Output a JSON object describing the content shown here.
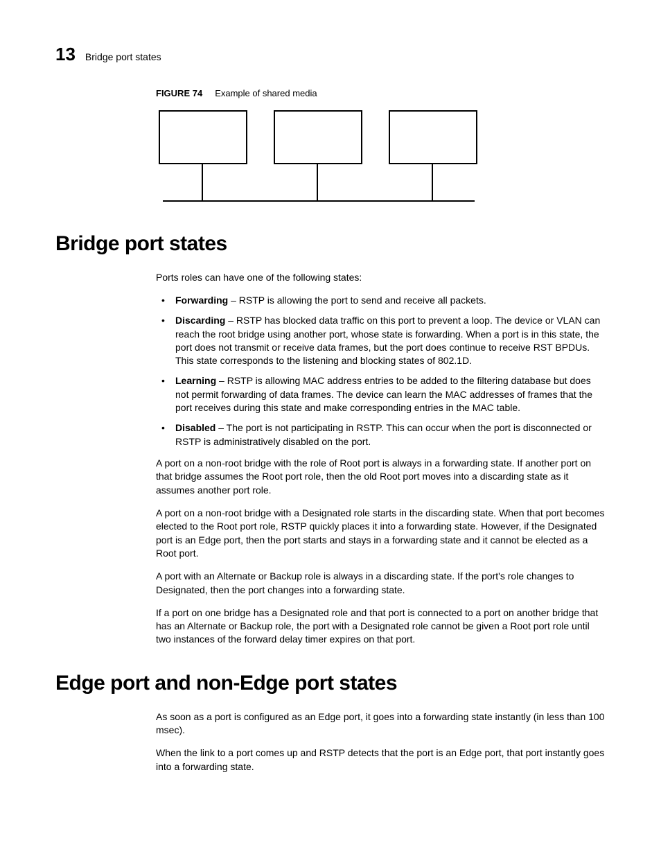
{
  "header": {
    "page_number": "13",
    "running_title": "Bridge port states"
  },
  "figure": {
    "label": "FIGURE 74",
    "caption": "Example of shared media"
  },
  "section1": {
    "heading": "Bridge port states",
    "intro": "Ports roles can have one of the following states:",
    "bullets": [
      {
        "term": "Forwarding",
        "desc": " – RSTP is allowing the port to send and receive all packets."
      },
      {
        "term": "Discarding",
        "desc": " – RSTP has blocked data traffic on this port to prevent a loop. The device or VLAN can reach the root bridge using another port, whose state is forwarding. When a port is in this state, the port does not transmit or receive data frames, but the port does continue to receive RST BPDUs. This state corresponds to the listening and blocking states of 802.1D."
      },
      {
        "term": "Learning",
        "desc": " – RSTP is allowing MAC address entries to be added to the filtering database but does not permit forwarding of data frames. The device can learn the MAC addresses of frames that the port receives during this state and make corresponding entries in the MAC table."
      },
      {
        "term": "Disabled",
        "desc": " – The port is not participating in RSTP. This can occur when the port is disconnected or RSTP is administratively disabled on the port."
      }
    ],
    "paras": [
      "A port on a non-root bridge with the role of Root port is always in a forwarding state. If another port on that bridge assumes the Root port role, then the old Root port moves into a discarding state as it assumes another port role.",
      "A port on a non-root bridge with a Designated role starts in the discarding state. When that port becomes elected to the Root port role, RSTP quickly places it into a forwarding state. However, if the Designated port is an Edge port, then the port starts and stays in a forwarding state and it cannot be elected as a Root port.",
      "A port with an Alternate or Backup role is always in a discarding state. If the port's role changes to Designated, then the port changes into a forwarding state.",
      "If a port on one bridge has a Designated role and that port is connected to a port on another bridge that has an Alternate or Backup role, the port with a Designated role cannot be given a Root port role until two instances of the forward delay timer expires on that port."
    ]
  },
  "section2": {
    "heading": "Edge port and non-Edge port states",
    "paras": [
      "As soon as a port is configured as an Edge port, it goes into a forwarding state instantly (in less than 100 msec).",
      "When the link to a port comes up and RSTP detects that the port is an Edge port, that port instantly goes into a forwarding state."
    ]
  }
}
